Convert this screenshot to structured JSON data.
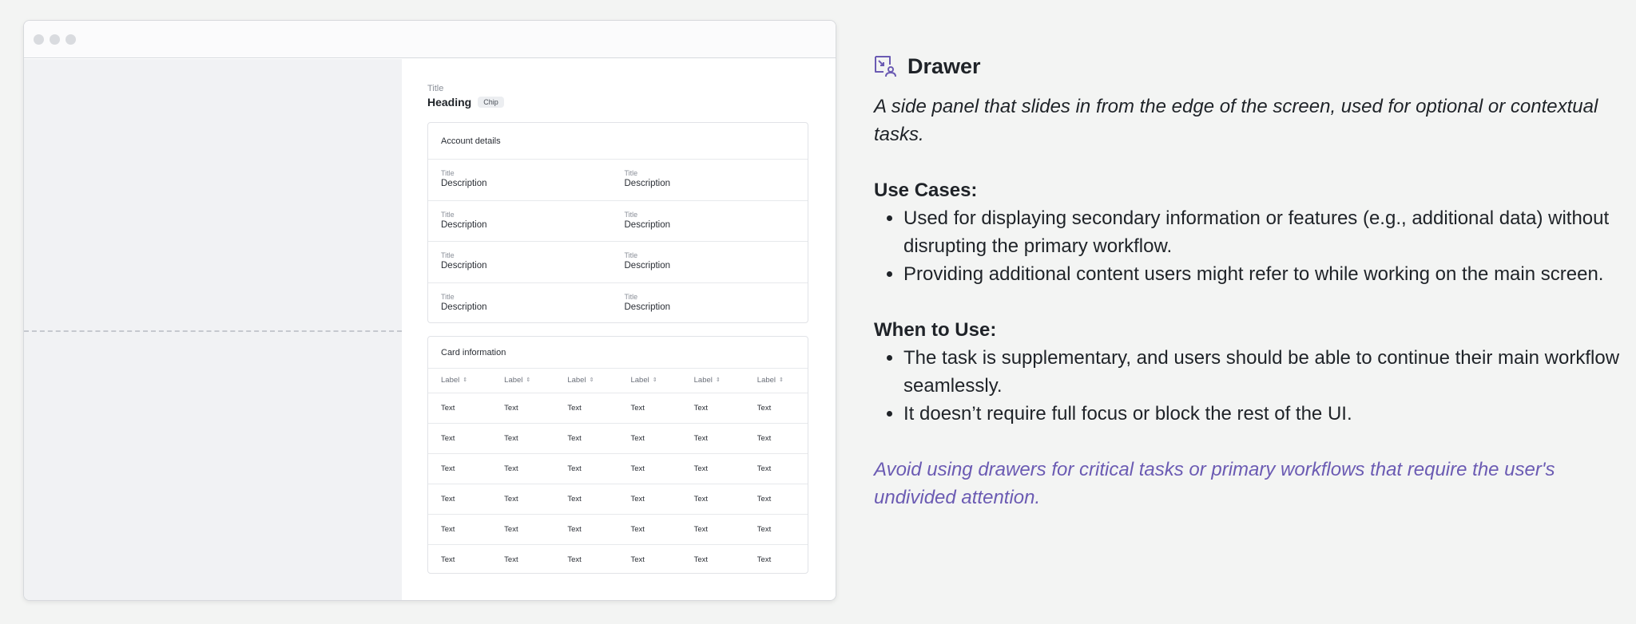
{
  "drawer_mock": {
    "overline": "Title",
    "heading": "Heading",
    "chip": "Chip",
    "account_card": {
      "title": "Account details",
      "rows": [
        [
          {
            "title": "Title",
            "desc": "Description"
          },
          {
            "title": "Title",
            "desc": "Description"
          }
        ],
        [
          {
            "title": "Title",
            "desc": "Description"
          },
          {
            "title": "Title",
            "desc": "Description"
          }
        ],
        [
          {
            "title": "Title",
            "desc": "Description"
          },
          {
            "title": "Title",
            "desc": "Description"
          }
        ],
        [
          {
            "title": "Title",
            "desc": "Description"
          },
          {
            "title": "Title",
            "desc": "Description"
          }
        ]
      ]
    },
    "info_card": {
      "title": "Card information",
      "columns": [
        "Label",
        "Label",
        "Label",
        "Label",
        "Label",
        "Label"
      ],
      "rows": [
        [
          "Text",
          "Text",
          "Text",
          "Text",
          "Text",
          "Text"
        ],
        [
          "Text",
          "Text",
          "Text",
          "Text",
          "Text",
          "Text"
        ],
        [
          "Text",
          "Text",
          "Text",
          "Text",
          "Text",
          "Text"
        ],
        [
          "Text",
          "Text",
          "Text",
          "Text",
          "Text",
          "Text"
        ],
        [
          "Text",
          "Text",
          "Text",
          "Text",
          "Text",
          "Text"
        ],
        [
          "Text",
          "Text",
          "Text",
          "Text",
          "Text",
          "Text"
        ]
      ]
    }
  },
  "doc": {
    "icon": "drawer-icon",
    "title": "Drawer",
    "lead": "A side panel that slides in from the edge of the screen, used for optional or contextual tasks.",
    "use_cases_heading": "Use Cases:",
    "use_cases": [
      "Used for displaying secondary information or features (e.g., additional data) without disrupting the primary workflow.",
      "Providing additional content users might refer to while working on the main screen."
    ],
    "when_heading": "When to Use:",
    "when_items": [
      "The task is supplementary, and users should be able to continue their main workflow seamlessly.",
      "It doesn’t require full focus or block the rest of the UI."
    ],
    "warning": "Avoid using drawers for critical tasks or primary workflows that require the user's undivided attention.",
    "accent_color": "#6b5bb3"
  }
}
